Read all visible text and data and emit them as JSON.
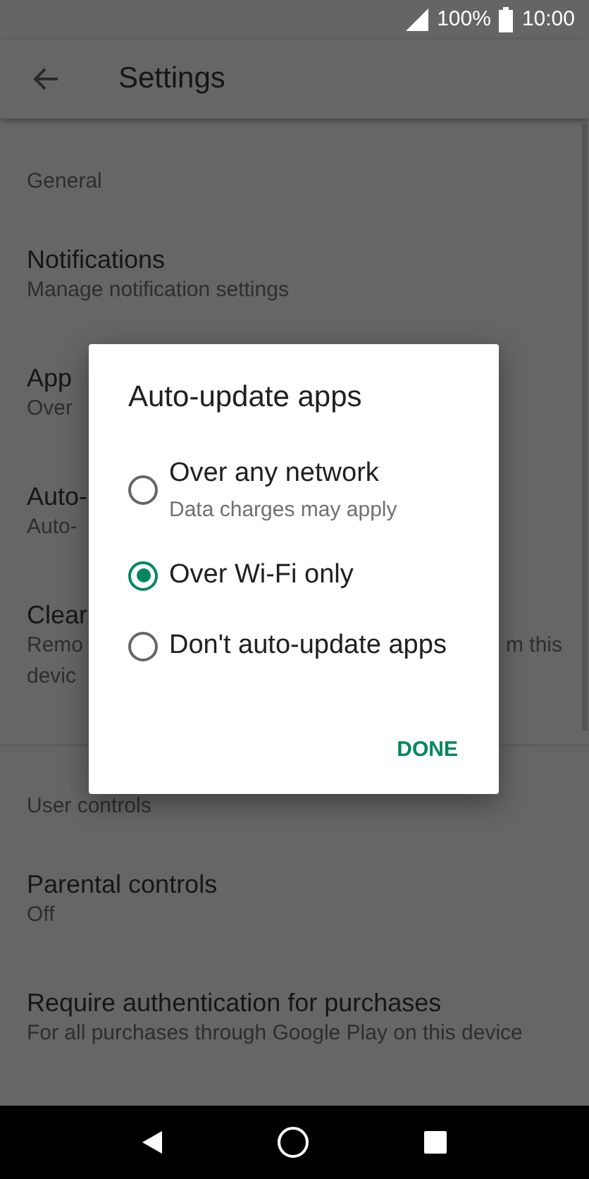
{
  "status_bar": {
    "battery": "100%",
    "time": "10:00"
  },
  "toolbar": {
    "title": "Settings"
  },
  "sections": [
    {
      "header": "General",
      "items": [
        {
          "title": "Notifications",
          "subtitle": "Manage notification settings"
        },
        {
          "title": "App",
          "subtitle": "Over"
        },
        {
          "title": "Auto-",
          "subtitle": "Auto-"
        },
        {
          "title": "Clear",
          "subtitle": "Remo",
          "subtitle_end": "m this",
          "subtitle_2": "devic"
        }
      ]
    },
    {
      "header": "User controls",
      "items": [
        {
          "title": "Parental controls",
          "subtitle": "Off"
        },
        {
          "title": "Require authentication for purchases",
          "subtitle": "For all purchases through Google Play on this device"
        }
      ]
    }
  ],
  "dialog": {
    "title": "Auto-update apps",
    "options": [
      {
        "label": "Over any network",
        "sublabel": "Data charges may apply",
        "selected": false
      },
      {
        "label": "Over Wi-Fi only",
        "selected": true
      },
      {
        "label": "Don't auto-update apps",
        "selected": false
      }
    ],
    "button": "DONE"
  }
}
